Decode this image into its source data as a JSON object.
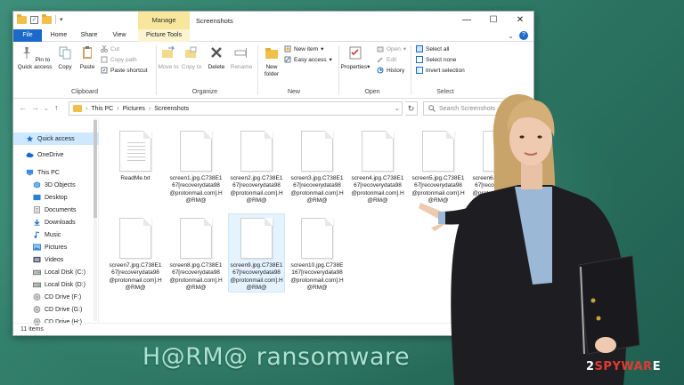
{
  "window": {
    "title": "Screenshots",
    "manage_tab": "Manage",
    "controls": {
      "minimize": "—",
      "maximize": "☐",
      "close": "✕"
    }
  },
  "tabs": [
    "File",
    "Home",
    "Share",
    "View",
    "Picture Tools"
  ],
  "ribbon": {
    "clipboard": {
      "label": "Clipboard",
      "pin": "Pin to Quick access",
      "copy": "Copy",
      "paste": "Paste",
      "cut": "Cut",
      "copy_path": "Copy path",
      "paste_shortcut": "Paste shortcut"
    },
    "organize": {
      "label": "Organize",
      "move_to": "Move to",
      "copy_to": "Copy to",
      "delete": "Delete",
      "rename": "Rename"
    },
    "new": {
      "label": "New",
      "new_folder": "New folder",
      "new_item": "New item",
      "easy_access": "Easy access"
    },
    "open": {
      "label": "Open",
      "properties": "Properties",
      "open": "Open",
      "edit": "Edit",
      "history": "History"
    },
    "select": {
      "label": "Select",
      "select_all": "Select all",
      "select_none": "Select none",
      "invert_selection": "Invert selection"
    }
  },
  "address": {
    "crumbs": [
      "This PC",
      "Pictures",
      "Screenshots"
    ],
    "search_placeholder": "Search Screenshots"
  },
  "nav": [
    {
      "label": "Quick access",
      "icon": "star-icon"
    },
    {
      "label": "OneDrive",
      "icon": "cloud-icon"
    },
    {
      "label": "This PC",
      "icon": "computer-icon"
    },
    {
      "label": "3D Objects",
      "icon": "cube-icon"
    },
    {
      "label": "Desktop",
      "icon": "desktop-icon"
    },
    {
      "label": "Documents",
      "icon": "document-icon"
    },
    {
      "label": "Downloads",
      "icon": "download-icon"
    },
    {
      "label": "Music",
      "icon": "music-icon"
    },
    {
      "label": "Pictures",
      "icon": "picture-icon"
    },
    {
      "label": "Videos",
      "icon": "video-icon"
    },
    {
      "label": "Local Disk (C:)",
      "icon": "drive-icon"
    },
    {
      "label": "Local Disk (D:)",
      "icon": "drive-icon"
    },
    {
      "label": "CD Drive (F:)",
      "icon": "cd-icon"
    },
    {
      "label": "CD Drive (G:)",
      "icon": "cd-icon"
    },
    {
      "label": "CD Drive (H:)",
      "icon": "cd-icon"
    }
  ],
  "files": [
    {
      "name": "ReadMe.txt",
      "lines": true
    },
    {
      "name": "screen1.jpg.C738E167[recoverydata98@protonmail.com].H@RM@"
    },
    {
      "name": "screen2.jpg.C738E167[recoverydata98@protonmail.com].H@RM@"
    },
    {
      "name": "screen3.jpg.C738E167[recoverydata98@protonmail.com].H@RM@"
    },
    {
      "name": "screen4.jpg.C738E167[recoverydata98@protonmail.com].H@RM@"
    },
    {
      "name": "screen5.jpg.C738E167[recoverydata98@protonmail.com].H@RM@"
    },
    {
      "name": "screen6.jpg.C738E167[recoverydata98@protonmail.com].H@RM@"
    },
    {
      "name": "screen7.jpg.C738E167[recoverydata98@protonmail.com].H@RM@"
    },
    {
      "name": "screen8.jpg.C738E167[recoverydata98@protonmail.com].H@RM@"
    },
    {
      "name": "screen9.jpg.C738E167[recoverydata98@protonmail.com].H@RM@",
      "selected": true
    },
    {
      "name": "screen10.jpg.C738E167[recoverydata98@protonmail.com].H@RM@"
    }
  ],
  "status": {
    "items": "11 items"
  },
  "caption": "H@RM@ ransomware",
  "logo": {
    "prefix": "2",
    "accent": "SPYWAR",
    "suffix": "E"
  },
  "colors": {
    "accent": "#1b6ac9",
    "manage": "#f7e69b",
    "selection": "#cde8ff",
    "background": "#3d8f7a"
  }
}
